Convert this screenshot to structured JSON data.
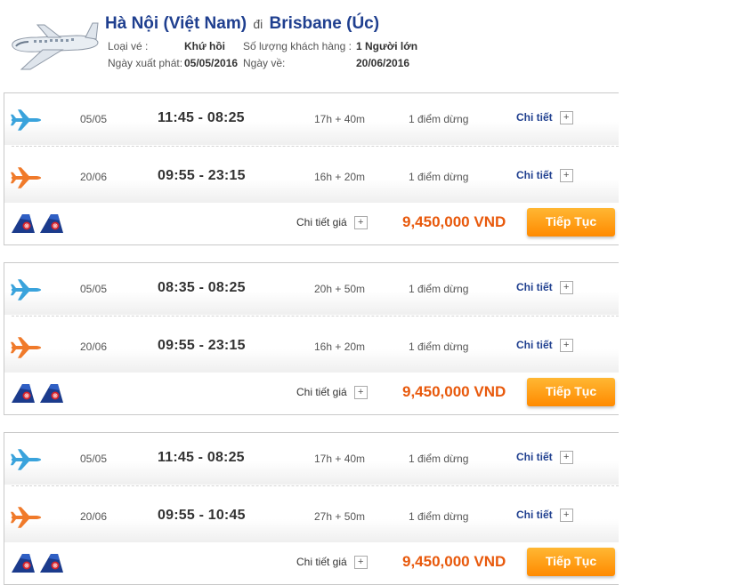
{
  "header": {
    "origin": "Hà Nội (Việt Nam)",
    "connector": "đi",
    "destination": "Brisbane (Úc)",
    "ticket_type_label": "Loại vé :",
    "ticket_type_value": "Khứ hồi",
    "passengers_label": "Số lượng khách hàng :",
    "passengers_value": "1 Người lớn",
    "depart_label": "Ngày xuất phát:",
    "depart_value": "05/05/2016",
    "return_label": "Ngày về:",
    "return_value": "20/06/2016"
  },
  "results": [
    {
      "outbound": {
        "date": "05/05",
        "time": "11:45 - 08:25",
        "duration": "17h + 40m",
        "stops": "1 điểm dừng",
        "detail": "Chi tiết",
        "plus": "+"
      },
      "inbound": {
        "date": "20/06",
        "time": "09:55 - 23:15",
        "duration": "16h + 20m",
        "stops": "1 điểm dừng",
        "detail": "Chi tiết",
        "plus": "+"
      },
      "price_detail": "Chi tiết giá",
      "plus": "+",
      "price": "9,450,000 VND",
      "button": "Tiếp Tục"
    },
    {
      "outbound": {
        "date": "05/05",
        "time": "08:35 - 08:25",
        "duration": "20h + 50m",
        "stops": "1 điểm dừng",
        "detail": "Chi tiết",
        "plus": "+"
      },
      "inbound": {
        "date": "20/06",
        "time": "09:55 - 23:15",
        "duration": "16h + 20m",
        "stops": "1 điểm dừng",
        "detail": "Chi tiết",
        "plus": "+"
      },
      "price_detail": "Chi tiết giá",
      "plus": "+",
      "price": "9,450,000 VND",
      "button": "Tiếp Tục"
    },
    {
      "outbound": {
        "date": "05/05",
        "time": "11:45 - 08:25",
        "duration": "17h + 40m",
        "stops": "1 điểm dừng",
        "detail": "Chi tiết",
        "plus": "+"
      },
      "inbound": {
        "date": "20/06",
        "time": "09:55 - 10:45",
        "duration": "27h + 50m",
        "stops": "1 điểm dừng",
        "detail": "Chi tiết",
        "plus": "+"
      },
      "price_detail": "Chi tiết giá",
      "plus": "+",
      "price": "9,450,000 VND",
      "button": "Tiếp Tục"
    }
  ],
  "colors": {
    "outbound_plane": "#3aa3dc",
    "inbound_plane": "#f07a2a",
    "price": "#e8590c",
    "button": "#ff9a14",
    "title": "#1f3f8f"
  }
}
